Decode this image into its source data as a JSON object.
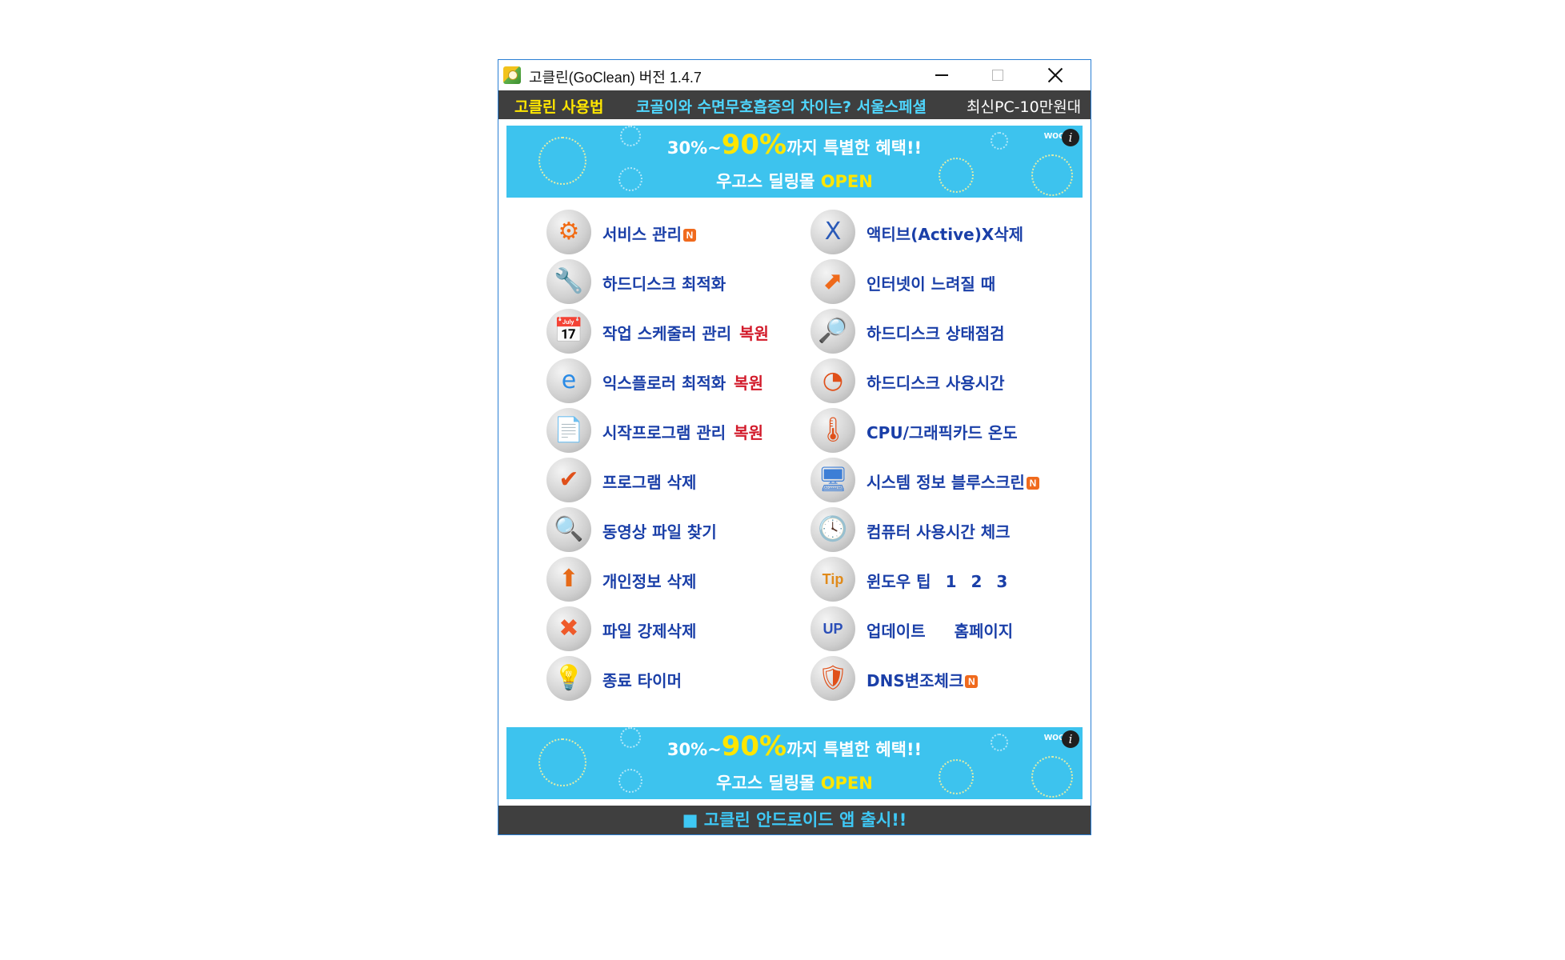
{
  "window": {
    "title": "고클린(GoClean) 버전 1.4.7"
  },
  "topnav": {
    "howto": "고클린 사용법",
    "news1": "코골이와 수면무호흡증의 차이는? 서울스페셜",
    "news2": "최신PC-10만원대"
  },
  "banner": {
    "prefix": "30%~",
    "percent": "90%",
    "suffix": "까지 특별한 혜택!!",
    "mall": "우고스 딜링몰 ",
    "open": "OPEN",
    "brand": "woo"
  },
  "colors": {
    "accent_label": "#1a3fa8",
    "restore": "#d21a2a",
    "nav_bg": "#3f3f3f",
    "banner_bg": "#3dc3ee"
  },
  "menu": {
    "left": [
      {
        "label": "서비스 관리",
        "icon": "gear-icon",
        "badge": "N"
      },
      {
        "label": "하드디스크 최적화",
        "icon": "wrench-disk-icon"
      },
      {
        "label": "작업 스케줄러 관리",
        "icon": "scheduler-icon",
        "extra": "복원"
      },
      {
        "label": "익스플로러 최적화",
        "icon": "ie-icon",
        "extra": "복원"
      },
      {
        "label": "시작프로그램 관리",
        "icon": "document-icon",
        "extra": "복원"
      },
      {
        "label": "프로그램 삭제",
        "icon": "checklist-icon"
      },
      {
        "label": "동영상 파일 찾기",
        "icon": "magnifier-icon"
      },
      {
        "label": "개인정보 삭제",
        "icon": "privacy-icon"
      },
      {
        "label": "파일 강제삭제",
        "icon": "delete-x-icon"
      },
      {
        "label": "종료 타이머",
        "icon": "bulb-timer-icon"
      }
    ],
    "right": [
      {
        "label": "액티브(Active)X삭제",
        "icon": "activex-icon"
      },
      {
        "label": "인터넷이 느려질 때",
        "icon": "arrow-up-icon"
      },
      {
        "label": "하드디스크 상태점검",
        "icon": "disk-search-icon"
      },
      {
        "label": "하드디스크 사용시간",
        "icon": "disk-clock-icon"
      },
      {
        "label": "CPU/그래픽카드 온도",
        "icon": "thermometer-icon"
      },
      {
        "label": "시스템 정보 블루스크린",
        "icon": "computer-icon",
        "badge": "N"
      },
      {
        "label": "컴퓨터 사용시간 체크",
        "icon": "clock-icon"
      },
      {
        "label": "윈도우 팁",
        "icon": "tip-icon",
        "links": [
          "1",
          "2",
          "3"
        ]
      },
      {
        "label": "업데이트",
        "icon": "update-icon",
        "extra_link": "홈페이지"
      },
      {
        "label": "DNS변조체크",
        "icon": "shield-icon",
        "badge": "N"
      }
    ]
  },
  "footer": {
    "text": "■ 고클린 안드로이드 앱 출시!!"
  }
}
